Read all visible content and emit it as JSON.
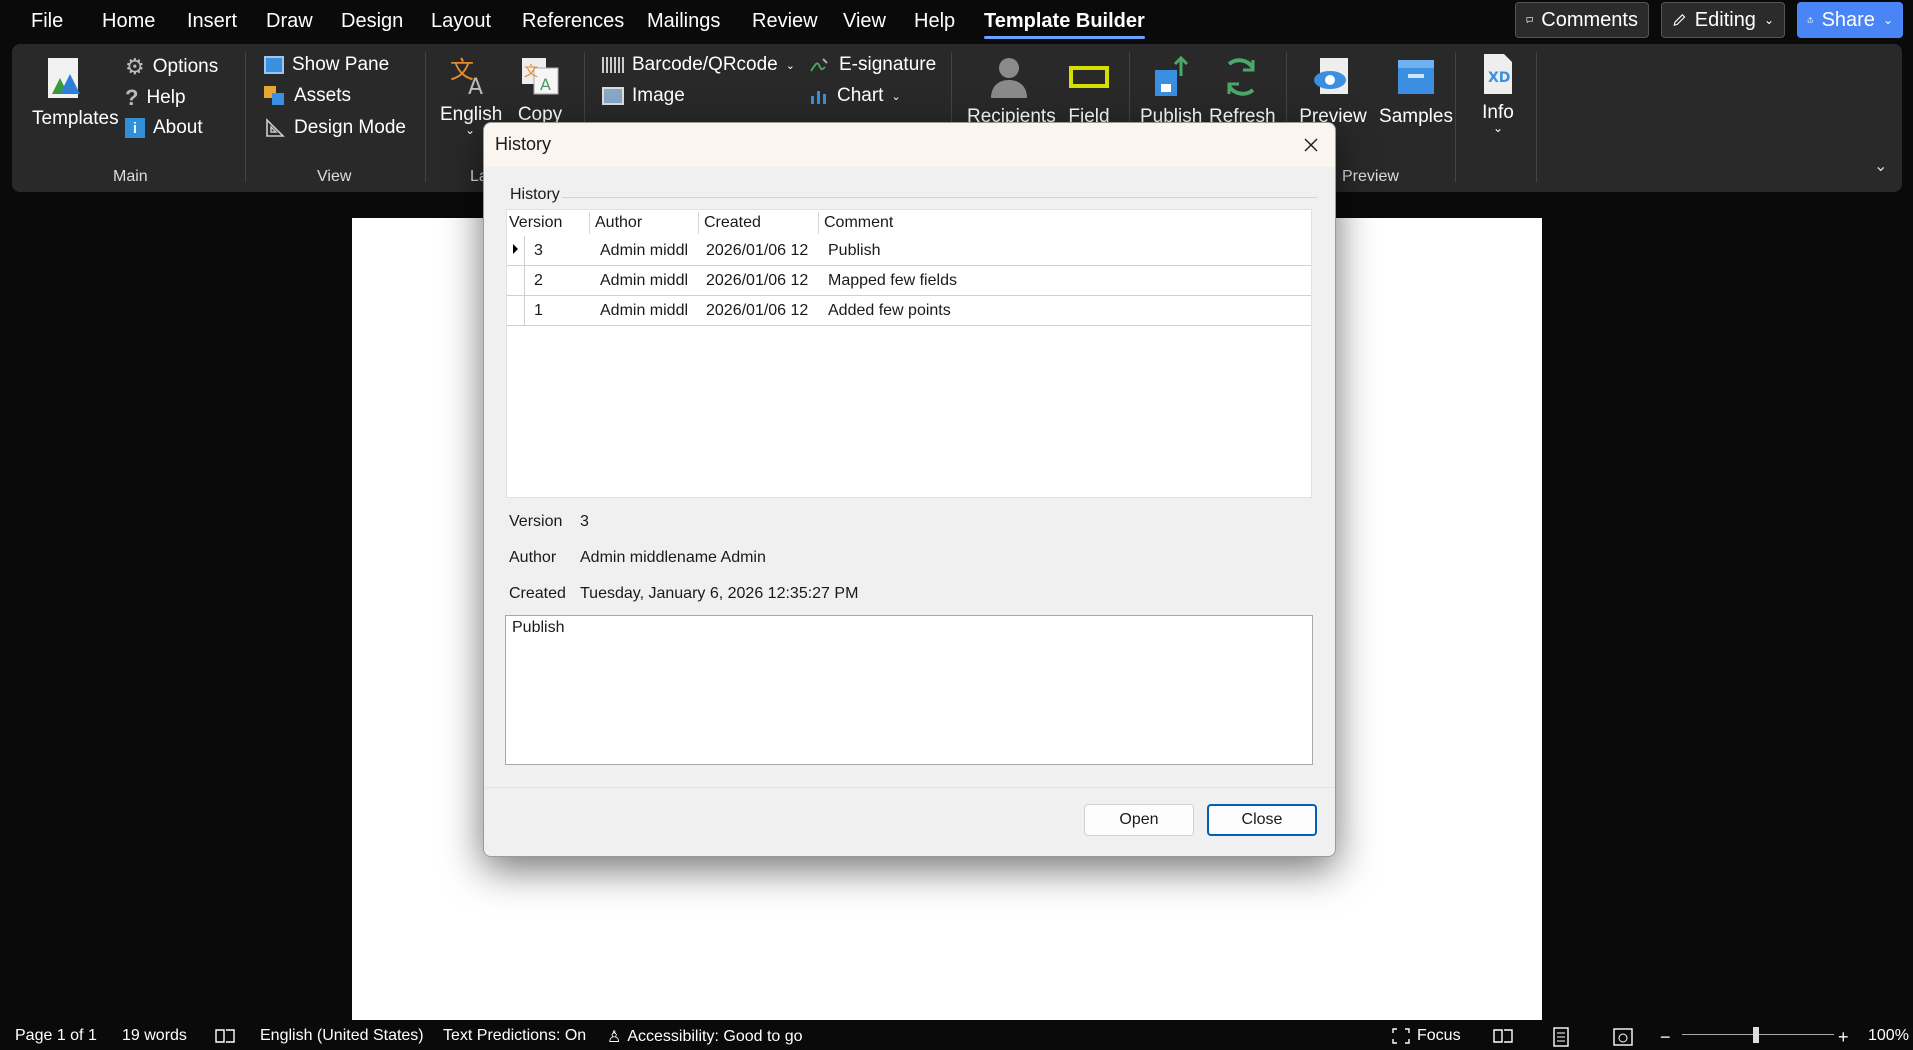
{
  "menubar": {
    "tabs": [
      "File",
      "Home",
      "Insert",
      "Draw",
      "Design",
      "Layout",
      "References",
      "Mailings",
      "Review",
      "View",
      "Help",
      "Template Builder"
    ],
    "active_tab": "Template Builder",
    "comments_label": "Comments",
    "editing_label": "Editing",
    "share_label": "Share"
  },
  "ribbon": {
    "main": {
      "templates": "Templates",
      "options": "Options",
      "help": "Help",
      "about": "About",
      "group": "Main"
    },
    "view": {
      "show_pane": "Show Pane",
      "assets": "Assets",
      "design_mode": "Design Mode",
      "group": "View"
    },
    "language": {
      "english": "English",
      "copy": "Copy",
      "group": "La"
    },
    "insert": {
      "barcode": "Barcode/QRcode",
      "esignature": "E-signature",
      "image": "Image",
      "chart": "Chart"
    },
    "data": {
      "recipients": "Recipients",
      "field": "Field"
    },
    "publish": {
      "publish": "Publish",
      "refresh": "Refresh"
    },
    "preview": {
      "preview": "Preview",
      "samples": "Samples",
      "group": "Preview"
    },
    "info": {
      "info": "Info"
    }
  },
  "dialog": {
    "title": "History",
    "group_label": "History",
    "columns": [
      "Version",
      "Author",
      "Created",
      "Comment"
    ],
    "rows": [
      {
        "version": "3",
        "author": "Admin middl",
        "created": "2026/01/06 12",
        "comment": "Publish"
      },
      {
        "version": "2",
        "author": "Admin middl",
        "created": "2026/01/06 12",
        "comment": "Mapped few fields"
      },
      {
        "version": "1",
        "author": "Admin middl",
        "created": "2026/01/06 12",
        "comment": "Added few points"
      }
    ],
    "details": {
      "version_label": "Version",
      "version_value": "3",
      "author_label": "Author",
      "author_value": "Admin middlename Admin",
      "created_label": "Created",
      "created_value": "Tuesday, January 6, 2026 12:35:27 PM"
    },
    "comment_text": "Publish",
    "open_button": "Open",
    "close_button": "Close"
  },
  "statusbar": {
    "page": "Page 1 of 1",
    "words": "19 words",
    "language": "English (United States)",
    "text_predictions": "Text Predictions: On",
    "accessibility": "Accessibility: Good to go",
    "focus": "Focus",
    "zoom": "100%"
  }
}
